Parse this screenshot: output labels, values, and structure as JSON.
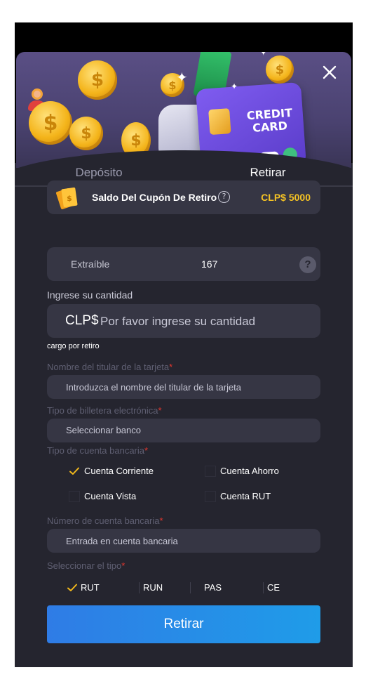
{
  "header": {
    "card_text": "CREDIT CARD",
    "close_icon": "close-icon",
    "support_icon": "support-agent-icon"
  },
  "tabs": [
    {
      "label": "Depósito",
      "active": false
    },
    {
      "label": "Retirar",
      "active": true
    }
  ],
  "coupon": {
    "label": "Saldo Del Cupón De Retiro",
    "help_icon": "question-circle-icon",
    "amount": "CLP$ 5000"
  },
  "withdrawable": {
    "label": "Extraíble",
    "value": "167",
    "help_glyph": "?"
  },
  "amount": {
    "label": "Ingrese su cantidad",
    "currency": "CLP$",
    "placeholder": "Por favor ingrese su cantidad"
  },
  "fee_text": "cargo por retiro",
  "cardholder": {
    "label": "Nombre del titular de la tarjeta",
    "required_mark": "*",
    "placeholder": "Introduzca el nombre del titular de la tarjeta"
  },
  "wallet_type": {
    "label": "Tipo de billetera electrónica",
    "required_mark": "*",
    "selected": "Seleccionar banco"
  },
  "account_type": {
    "label": "Tipo de cuenta bancaria",
    "required_mark": "*",
    "options": [
      {
        "label": "Cuenta Corriente",
        "checked": true
      },
      {
        "label": "Cuenta Ahorro",
        "checked": false
      },
      {
        "label": "Cuenta Vista",
        "checked": false
      },
      {
        "label": "Cuenta RUT",
        "checked": false
      }
    ]
  },
  "account_number": {
    "label": "Número de cuenta bancaria",
    "required_mark": "*",
    "placeholder": "Entrada en cuenta bancaria"
  },
  "id_type": {
    "label": "Seleccionar el tipo",
    "required_mark": "*",
    "options": [
      {
        "label": "RUT",
        "checked": true
      },
      {
        "label": "RUN",
        "checked": false
      },
      {
        "label": "PAS",
        "checked": false
      },
      {
        "label": "CE",
        "checked": false
      }
    ]
  },
  "submit_label": "Retirar",
  "colors": {
    "accent": "#f3b91b",
    "button": "#2f7ce6",
    "required": "#e2372f",
    "coupon_amount": "#f4c224",
    "background": "#25252f"
  }
}
